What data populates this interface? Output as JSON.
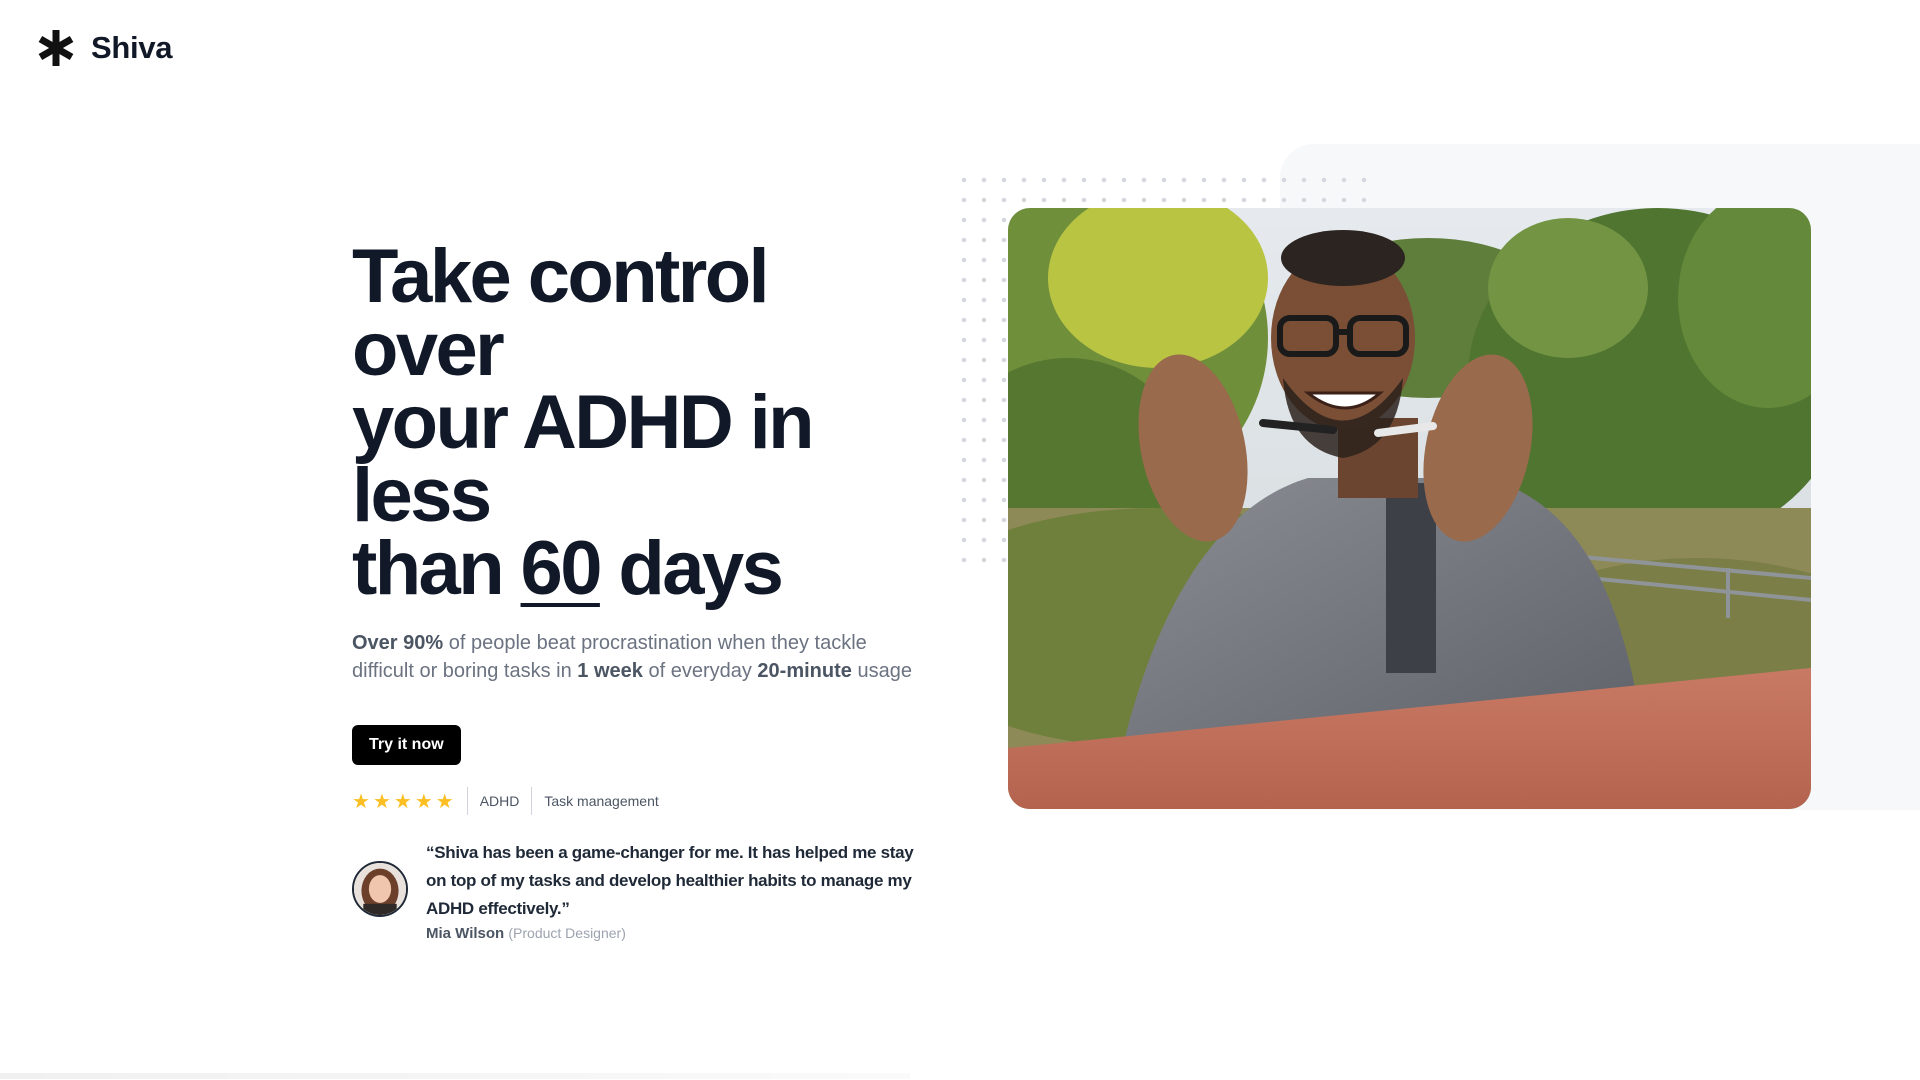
{
  "brand": {
    "name": "Shiva",
    "logo_icon": "asterisk-icon"
  },
  "hero": {
    "headline_line1": "Take control over",
    "headline_line2": "your ADHD in less",
    "headline_line3_start": "than ",
    "headline_highlight": "60",
    "headline_line3_end": " days",
    "sub_bold_1": "Over 90%",
    "sub_text_1": " of people beat procrastination when they tackle difficult or boring tasks in ",
    "sub_bold_2": "1 week",
    "sub_text_2": " of everyday ",
    "sub_bold_3": "20-minute",
    "sub_text_3": " usage",
    "cta_label": "Try it now",
    "photo_icon": "hero-photo"
  },
  "rating": {
    "stars": 5,
    "max_stars": 5,
    "star_glyph": "★",
    "star_color": "#fbbf24"
  },
  "tags": [
    "ADHD",
    "Task management"
  ],
  "testimonial": {
    "quote": "“Shiva has been a game-changer for me. It has helped me stay on top of my tasks and develop healthier habits to manage my ADHD effectively.”",
    "author_name": "Mia Wilson",
    "author_role": "(Product Designer)"
  },
  "colors": {
    "text_primary": "#111827",
    "text_muted": "#6b7280",
    "cta_bg": "#000000",
    "panel_bg": "#f7f8fa"
  }
}
